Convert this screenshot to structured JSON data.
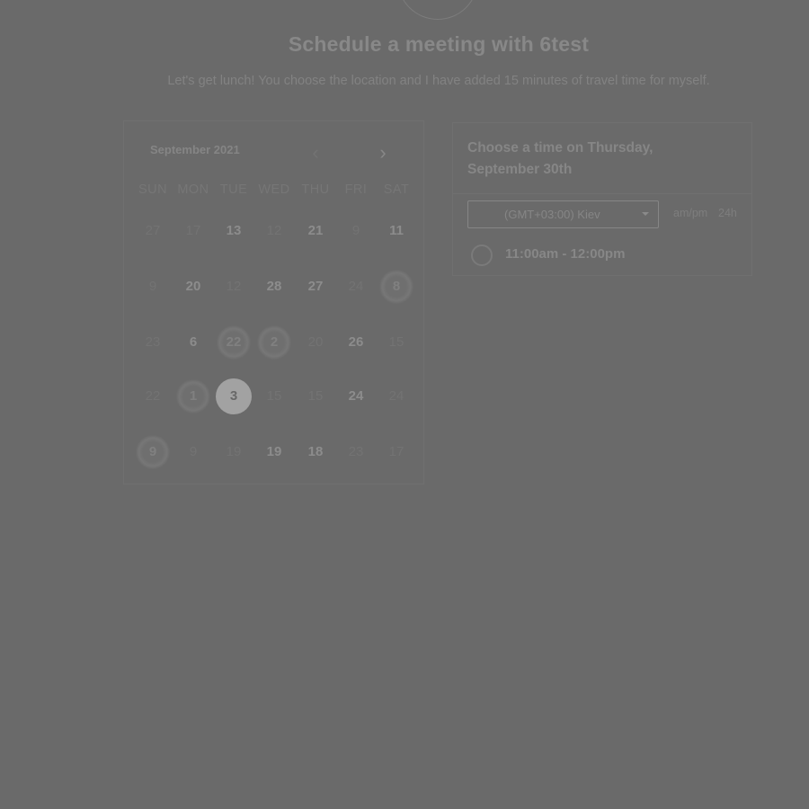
{
  "header": {
    "title": "Schedule a meeting with 6test",
    "subtitle": "Let's get lunch! You choose the location and I have added 15 minutes of travel time for myself."
  },
  "calendar": {
    "month_label": "September 2021",
    "prev_icon": "‹",
    "next_icon": "›",
    "weekdays": [
      "SUN",
      "MON",
      "TUE",
      "WED",
      "THU",
      "FRI",
      "SAT"
    ],
    "weeks": [
      [
        {
          "t": "27",
          "s": "dim"
        },
        {
          "t": "17",
          "s": "dim"
        },
        {
          "t": "13",
          "s": "avail"
        },
        {
          "t": "12",
          "s": "dim"
        },
        {
          "t": "21",
          "s": "avail"
        },
        {
          "t": "9",
          "s": "dim"
        },
        {
          "t": "11",
          "s": "avail"
        }
      ],
      [
        {
          "t": "9",
          "s": "dim"
        },
        {
          "t": "20",
          "s": "avail"
        },
        {
          "t": "12",
          "s": "dim"
        },
        {
          "t": "28",
          "s": "avail"
        },
        {
          "t": "27",
          "s": "avail"
        },
        {
          "t": "24",
          "s": "dim"
        },
        {
          "t": "8",
          "s": "fuzzy"
        }
      ],
      [
        {
          "t": "23",
          "s": "dim"
        },
        {
          "t": "6",
          "s": "avail"
        },
        {
          "t": "22",
          "s": "fuzzy"
        },
        {
          "t": "2",
          "s": "fuzzy"
        },
        {
          "t": "20",
          "s": "dim"
        },
        {
          "t": "26",
          "s": "avail"
        },
        {
          "t": "15",
          "s": "dim"
        }
      ],
      [
        {
          "t": "22",
          "s": "dim"
        },
        {
          "t": "1",
          "s": "fuzzy"
        },
        {
          "t": "3",
          "s": "selected"
        },
        {
          "t": "15",
          "s": "dim"
        },
        {
          "t": "15",
          "s": "dim"
        },
        {
          "t": "24",
          "s": "avail"
        },
        {
          "t": "24",
          "s": "dim"
        }
      ],
      [
        {
          "t": "9",
          "s": "fuzzy"
        },
        {
          "t": "9",
          "s": "dim"
        },
        {
          "t": "19",
          "s": "dim"
        },
        {
          "t": "19",
          "s": "avail"
        },
        {
          "t": "18",
          "s": "avail"
        },
        {
          "t": "23",
          "s": "dim"
        },
        {
          "t": "17",
          "s": "dim"
        }
      ]
    ]
  },
  "time_panel": {
    "heading": "Choose a time on Thursday, September 30th",
    "timezone": "(GMT+03:00) Kiev",
    "format_ampm": "am/pm",
    "format_24h": "24h",
    "slots": [
      {
        "label": "11:00am - 12:00pm"
      }
    ]
  },
  "colors": {
    "background": "#6a6a6a",
    "selected_day": "#a2a2a2"
  }
}
